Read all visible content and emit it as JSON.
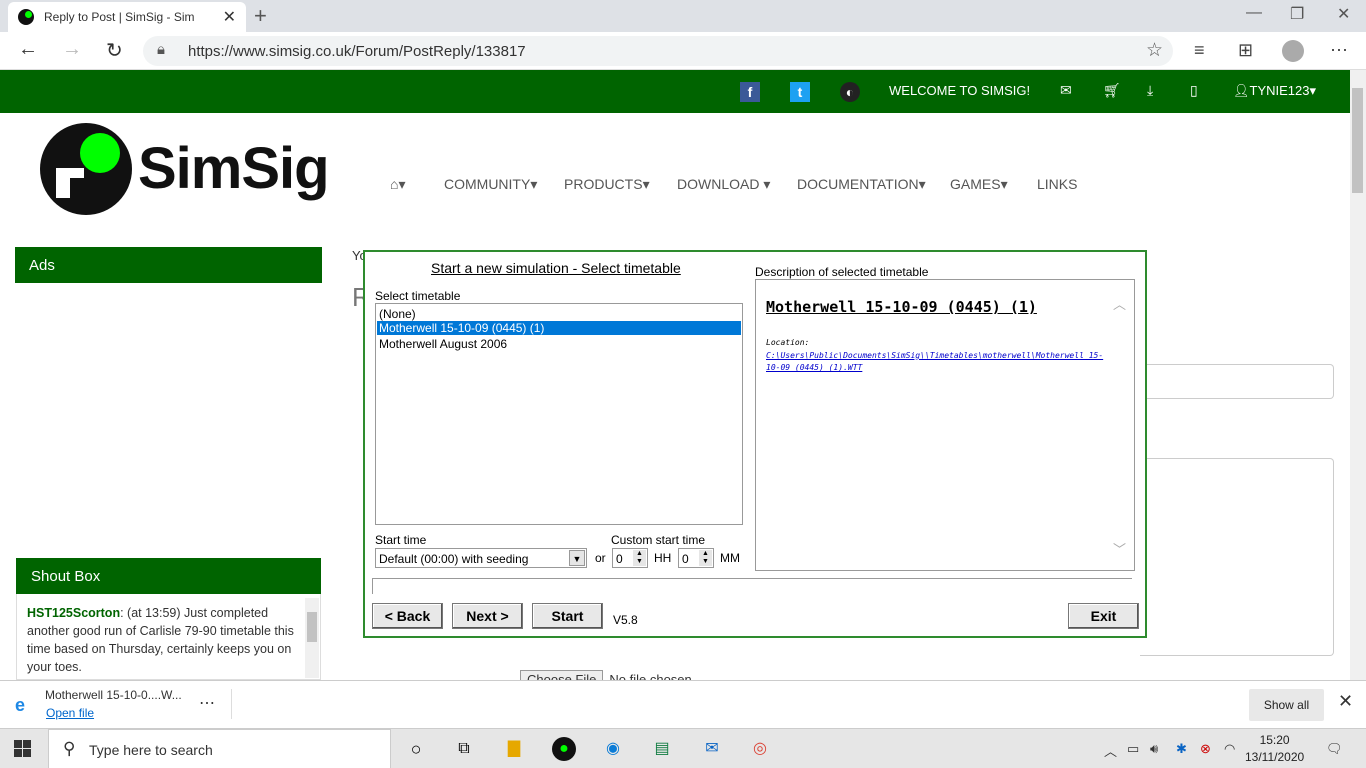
{
  "browser": {
    "tab_title": "Reply to Post | SimSig - Simulato",
    "url": "https://www.simsig.co.uk/Forum/PostReply/133817"
  },
  "site": {
    "welcome": "WELCOME TO SIMSIG!",
    "user": "TYNIE123",
    "logo_text": "SimSig",
    "menu": {
      "community": "COMMUNITY",
      "products": "PRODUCTS",
      "download": "DOWNLOAD",
      "documentation": "DOCUMENTATION",
      "games": "GAMES",
      "links": "LINKS"
    },
    "ads_title": "Ads",
    "shout_title": "Shout Box",
    "shout": {
      "author": "HST125Scorton",
      "text": ": (at 13:59) Just completed another good run of Carlisle 79-90 timetable this time based on Thursday, certainly keeps you on your toes."
    },
    "partial_yo": "Yo",
    "partial_r": "R",
    "choose_file": "Choose File",
    "no_file": "No file chosen"
  },
  "dialog": {
    "title": "Start a new simulation - Select timetable",
    "select_label": "Select timetable",
    "timetables": [
      "(None)",
      "Motherwell 15-10-09 (0445) (1)",
      "Motherwell August 2006"
    ],
    "start_time_label": "Start time",
    "start_time_value": "Default (00:00) with seeding",
    "or": "or",
    "custom_label": "Custom start time",
    "hh_value": "0",
    "hh_label": "HH",
    "mm_value": "0",
    "mm_label": "MM",
    "desc_label": "Description of selected timetable",
    "desc_title": "Motherwell 15-10-09 (0445) (1)",
    "desc_location_label": "Location:",
    "desc_path": "C:\\Users\\Public\\Documents\\SimSig\\\\Timetables\\motherwell\\Motherwell 15-10-09 (0445) (1).WTT",
    "back": "< Back",
    "next": "Next >",
    "start": "Start",
    "version": "V5.8",
    "exit": "Exit"
  },
  "download": {
    "filename": "Motherwell 15-10-0....W...",
    "open": "Open file",
    "show_all": "Show all"
  },
  "taskbar": {
    "search_placeholder": "Type here to search",
    "time": "15:20",
    "date": "13/11/2020"
  }
}
